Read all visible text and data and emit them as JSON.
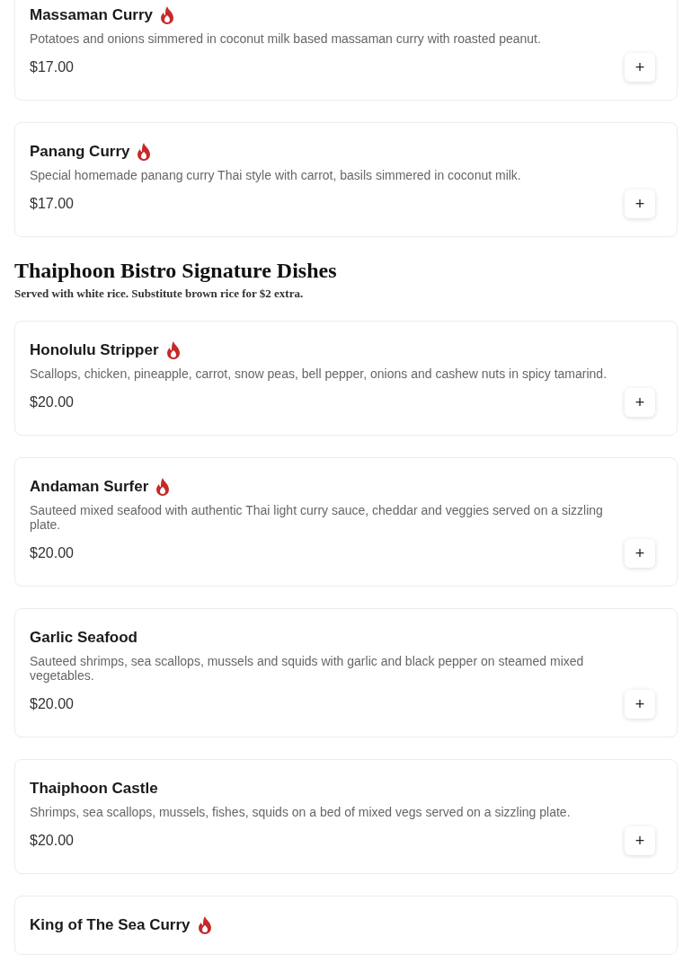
{
  "sections": [
    {
      "items": [
        {
          "name": "Massaman Curry",
          "spicy": true,
          "description": "Potatoes and onions simmered in coconut milk based massaman curry with roasted peanut.",
          "price": "$17.00",
          "add": "+"
        },
        {
          "name": "Panang Curry",
          "spicy": true,
          "description": "Special homemade panang curry Thai style with carrot, basils simmered in coconut milk.",
          "price": "$17.00",
          "add": "+"
        }
      ]
    },
    {
      "title": "Thaiphoon Bistro Signature Dishes",
      "subtitle": "Served with white rice. Substitute brown rice for $2 extra.",
      "items": [
        {
          "name": "Honolulu Stripper",
          "spicy": true,
          "description": "Scallops, chicken, pineapple, carrot, snow peas, bell pepper, onions and cashew nuts in spicy tamarind.",
          "price": "$20.00",
          "add": "+"
        },
        {
          "name": "Andaman Surfer",
          "spicy": true,
          "description": "Sauteed mixed seafood with authentic Thai light curry sauce, cheddar and veggies served on a sizzling plate.",
          "price": "$20.00",
          "add": "+"
        },
        {
          "name": "Garlic Seafood",
          "spicy": false,
          "description": "Sauteed shrimps, sea scallops, mussels and squids with garlic and black pepper on steamed mixed vegetables.",
          "price": "$20.00",
          "add": "+"
        },
        {
          "name": "Thaiphoon Castle",
          "spicy": false,
          "description": "Shrimps, sea scallops, mussels, fishes, squids on a bed of mixed vegs served on a sizzling plate.",
          "price": "$20.00",
          "add": "+"
        },
        {
          "name": "King of The Sea Curry",
          "spicy": true
        }
      ]
    }
  ]
}
